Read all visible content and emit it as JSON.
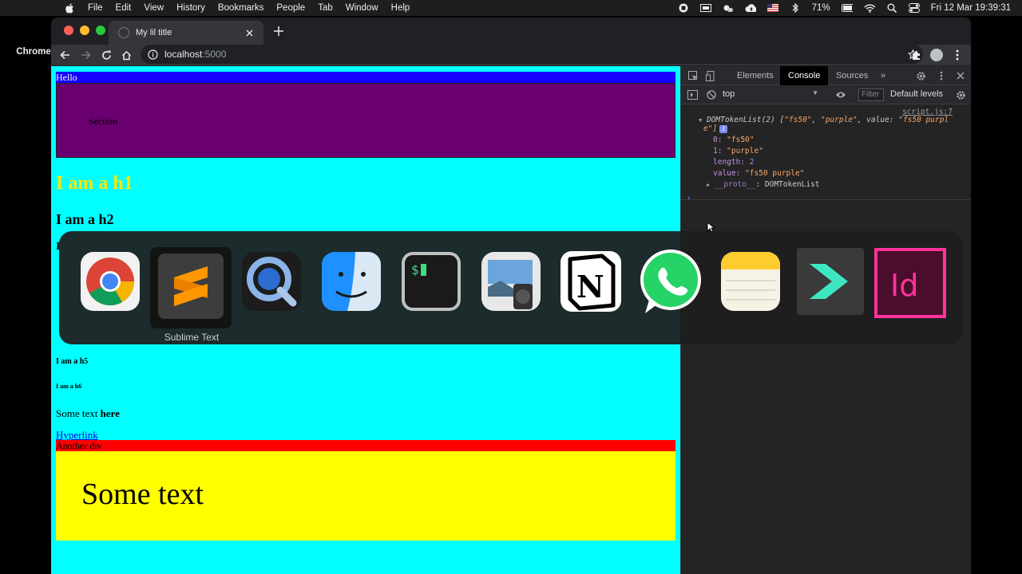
{
  "menubar": {
    "app": "Chrome",
    "items": [
      "File",
      "Edit",
      "View",
      "History",
      "Bookmarks",
      "People",
      "Tab",
      "Window",
      "Help"
    ],
    "battery": "71%",
    "datetime": "Fri 12 Mar  19:39:31"
  },
  "browser": {
    "tab_title": "My lil title",
    "url_host": "localhost",
    "url_port": ":5000"
  },
  "page": {
    "hello": "Hello",
    "section": "Section",
    "h1": "I am a h1",
    "h2": "I am a h2",
    "h3": "I",
    "h5": "I am a h5",
    "h6": "I am a h6",
    "para_text": "Some text ",
    "para_bold": "here",
    "link": "Hyperlink",
    "another_div": "Another div",
    "yellow_text": "Some text"
  },
  "devtools": {
    "tabs": [
      "Elements",
      "Console",
      "Sources"
    ],
    "active_tab": "Console",
    "more": "»",
    "context": "top",
    "filter": "Filter",
    "levels": "Default levels",
    "source_link": "script.js:7",
    "log": {
      "summary_type": "DOMTokenList(2) [",
      "summary_s1": "\"fs50\"",
      "summary_s2": "\"purple\"",
      "summary_valkey": "value: ",
      "summary_valstr": "\"fs50 purpl",
      "summary_wrap": "e\"]",
      "k0": "0: ",
      "v0": "\"fs50\"",
      "k1": "1: ",
      "v1": "\"purple\"",
      "k_len": "length: ",
      "v_len": "2",
      "k_val": "value: ",
      "v_val": "\"fs50 purple\"",
      "proto_key": "__proto__",
      "proto_val": ": DOMTokenList"
    }
  },
  "switcher": {
    "selected_label": "Sublime Text",
    "apps": [
      "chrome-icon",
      "sublime-text-icon",
      "quicktime-icon",
      "finder-icon",
      "terminal-icon",
      "preview-icon",
      "notion-icon",
      "whatsapp-icon",
      "notes-icon",
      "sourcetree-icon",
      "indesign-icon"
    ]
  },
  "colors": {
    "page_bg": "#00ffff",
    "hello_bg": "#1500ff",
    "section_bg": "#6a006f",
    "h1_color": "#ffe600",
    "another_div_bg": "#ff0000",
    "yellow_bg": "#ffff00"
  }
}
